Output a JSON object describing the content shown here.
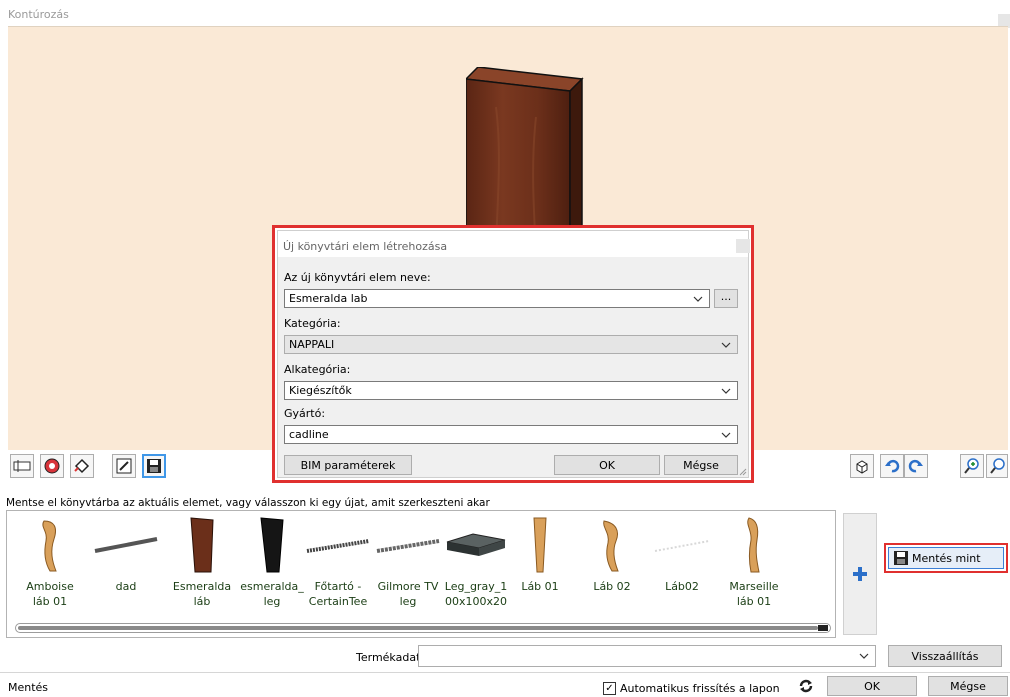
{
  "window": {
    "title": "Kontúrozás"
  },
  "hint": "Mentse el könyvtárba az aktuális elemet, vagy válasszon ki egy újat, amit szerkeszteni akar",
  "library": {
    "items": [
      {
        "label": "Amboise\nláb 01",
        "icon": "amboise-leg-thumb"
      },
      {
        "label": "dad",
        "icon": "rod-thumb"
      },
      {
        "label": "Esmeralda\nláb",
        "icon": "esmeralda-leg-thumb"
      },
      {
        "label": "esmeralda_\nleg",
        "icon": "black-leg-thumb"
      },
      {
        "label": "Főtartó -\nCertainTee",
        "icon": "beam-thumb"
      },
      {
        "label": "Gilmore TV\nleg",
        "icon": "beam-thumb"
      },
      {
        "label": "Leg_gray_1\n00x100x20",
        "icon": "gray-block-thumb"
      },
      {
        "label": "Láb 01",
        "icon": "tapered-leg-thumb"
      },
      {
        "label": "Láb 02",
        "icon": "curved-leg-thumb"
      },
      {
        "label": "Láb02",
        "icon": "faint-rod-thumb"
      },
      {
        "label": "Marseille\nláb 01",
        "icon": "curved-leg-thumb"
      }
    ]
  },
  "buttons": {
    "save_as": "Mentés mint",
    "reset": "Visszaállítás",
    "ok": "OK",
    "cancel": "Mégse"
  },
  "product_data": {
    "label": "Termékadat",
    "value": ""
  },
  "status": {
    "left": "Mentés",
    "auto_refresh": "Automatikus frissítés a lapon",
    "auto_refresh_checked": true
  },
  "dialog": {
    "title": "Új könyvtári elem létrehozása",
    "name_label": "Az új könyvtári elem neve:",
    "name_value": "Esmeralda lab",
    "browse": "...",
    "category_label": "Kategória:",
    "category_value": "NAPPALI",
    "subcategory_label": "Alkategória:",
    "subcategory_value": "Kiegészítők",
    "manufacturer_label": "Gyártó:",
    "manufacturer_value": "cadline",
    "bim_button": "BIM paraméterek",
    "ok": "OK",
    "cancel": "Mégse"
  },
  "colors": {
    "viewport_bg": "#fae9d6",
    "highlight_red": "#e0302f",
    "accent_blue": "#3f97e8",
    "label_green": "#1a3d14"
  }
}
